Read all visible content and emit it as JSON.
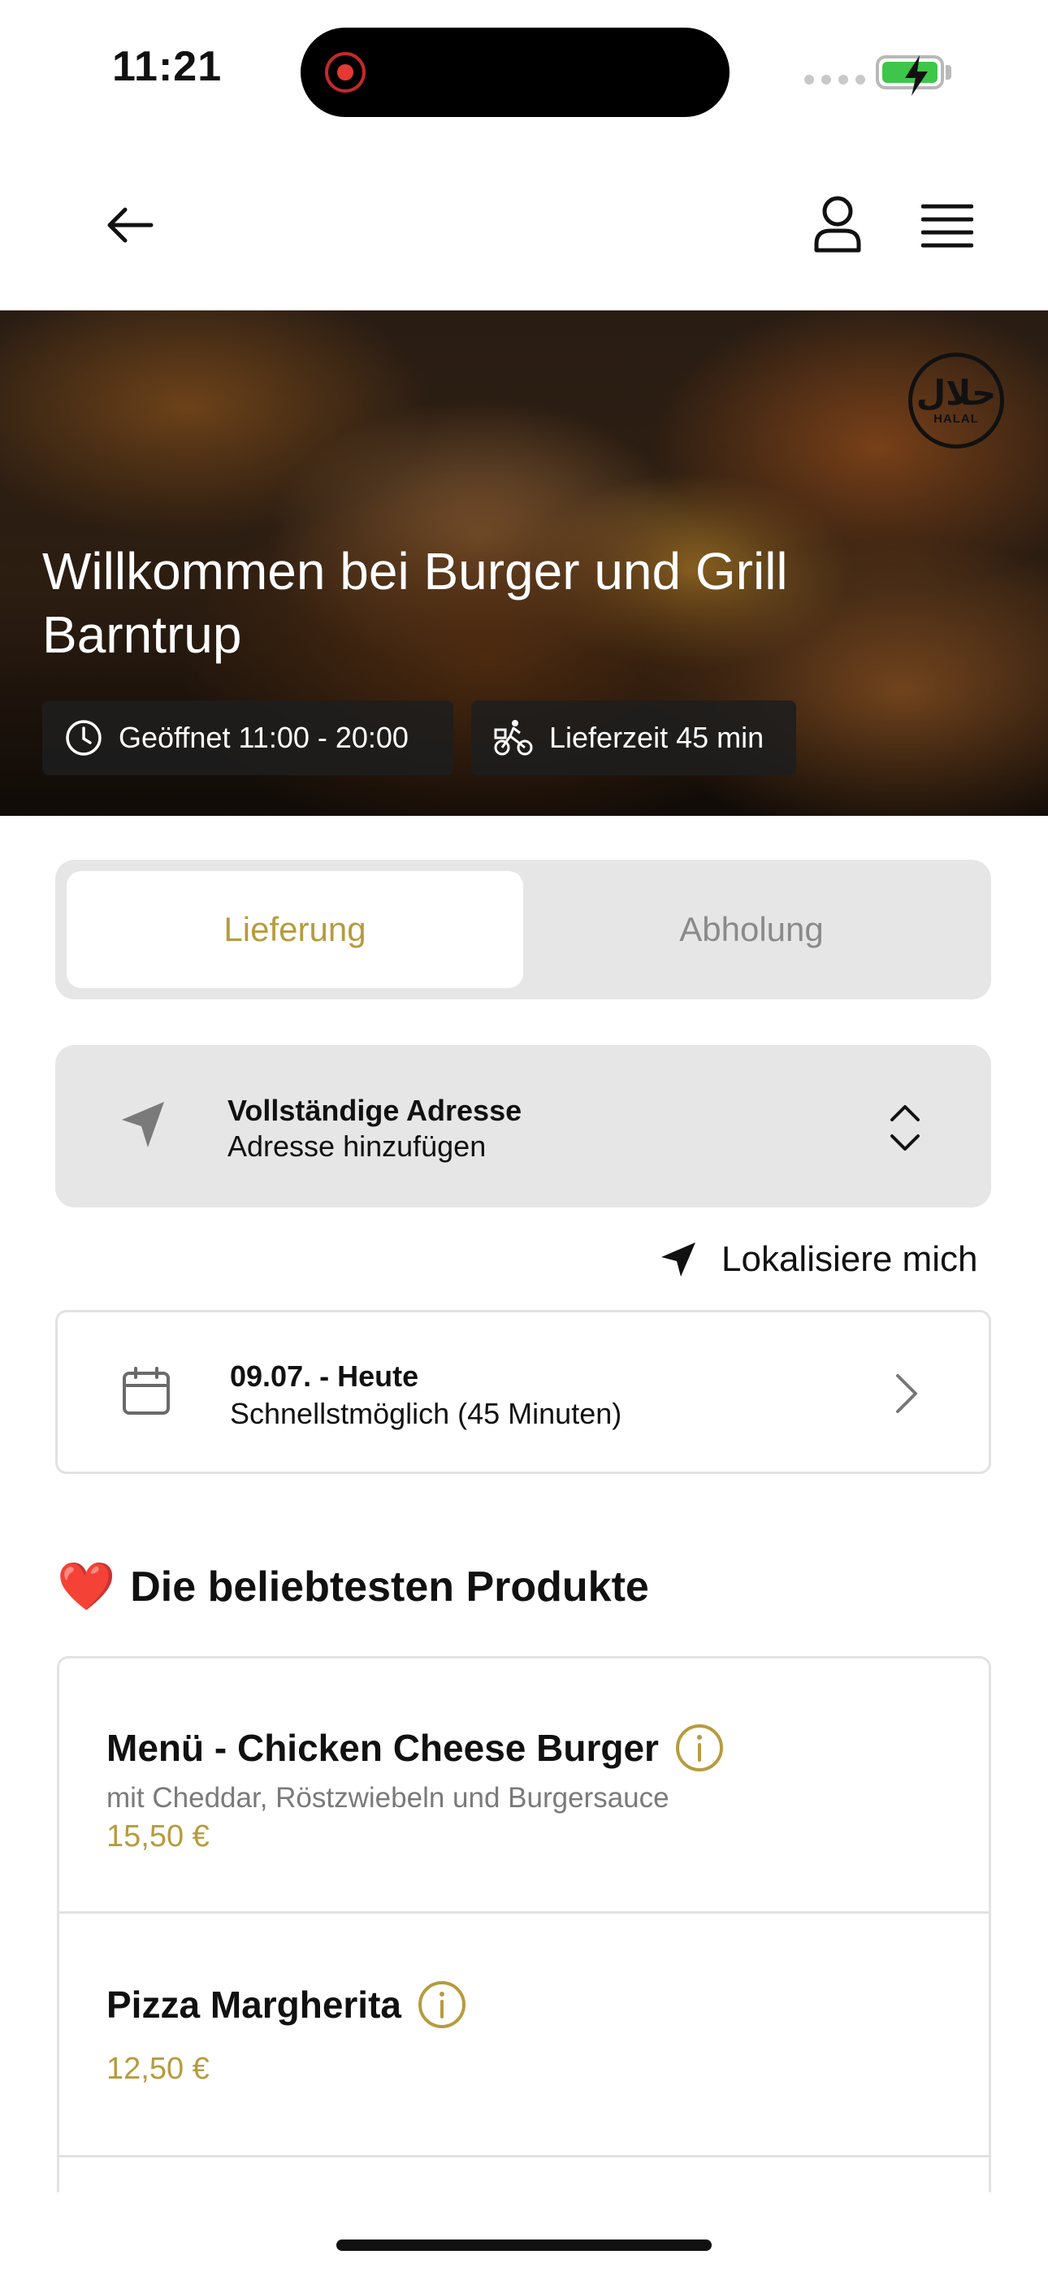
{
  "status_bar": {
    "time": "11:21"
  },
  "hero": {
    "title": "Willkommen bei Burger und Grill Barntrup",
    "halal_badge_arabic": "حلال",
    "halal_badge_latin": "HALAL",
    "opening_hours": "Geöffnet 11:00 - 20:00",
    "delivery_time": "Lieferzeit 45 min"
  },
  "order_mode": {
    "options": [
      "Lieferung",
      "Abholung"
    ],
    "selected": "Lieferung"
  },
  "address": {
    "title": "Vollständige Adresse",
    "placeholder": "Adresse hinzufügen"
  },
  "locate_me": "Lokalisiere mich",
  "schedule": {
    "date": "09.07. - Heute",
    "time": "Schnellstmöglich (45 Minuten)"
  },
  "popular": {
    "heading": "Die beliebtesten Produkte",
    "heading_icon": "❤️",
    "products": [
      {
        "name": "Menü - Chicken Cheese Burger",
        "description": "mit Cheddar, Röstzwiebeln und Burgersauce",
        "price": "15,50 €"
      },
      {
        "name": "Pizza Margherita",
        "description": "",
        "price": "12,50 €"
      }
    ]
  },
  "colors": {
    "accent": "#b79b3e",
    "toggle_bg": "#e6e6e6",
    "heart": "#e0202a"
  }
}
